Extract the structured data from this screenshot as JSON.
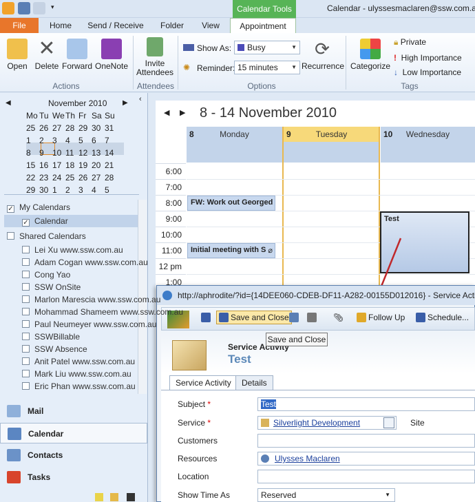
{
  "window": {
    "context_tab": "Calendar Tools",
    "title": "Calendar - ulyssesmaclaren@ssw.com.au"
  },
  "tabs": [
    "File",
    "Home",
    "Send / Receive",
    "Folder",
    "View",
    "Appointment"
  ],
  "ribbon": {
    "actions": {
      "open": "Open",
      "delete": "Delete",
      "forward": "Forward",
      "onenote": "OneNote",
      "group": "Actions"
    },
    "attendees": {
      "invite_line1": "Invite",
      "invite_line2": "Attendees",
      "group": "Attendees"
    },
    "options": {
      "show_as_label": "Show As:",
      "show_as_value": "Busy",
      "reminder_label": "Reminder:",
      "reminder_value": "15 minutes",
      "recurrence": "Recurrence",
      "group": "Options"
    },
    "tags": {
      "categorize": "Categorize",
      "private": "Private",
      "high": "High Importance",
      "low": "Low Importance",
      "group": "Tags"
    },
    "colors": {
      "file_tab": "#e8762b",
      "context": "#57b456"
    }
  },
  "mini_calendar": {
    "month": "November 2010",
    "weekdays": [
      "Mo",
      "Tu",
      "We",
      "Th",
      "Fr",
      "Sa",
      "Su"
    ],
    "weeks": [
      [
        "25",
        "26",
        "27",
        "28",
        "29",
        "30",
        "31"
      ],
      [
        "1",
        "2",
        "3",
        "4",
        "5",
        "6",
        "7"
      ],
      [
        "8",
        "9",
        "10",
        "11",
        "12",
        "13",
        "14"
      ],
      [
        "15",
        "16",
        "17",
        "18",
        "19",
        "20",
        "21"
      ],
      [
        "22",
        "23",
        "24",
        "25",
        "26",
        "27",
        "28"
      ],
      [
        "29",
        "30",
        "1",
        "2",
        "3",
        "4",
        "5"
      ]
    ],
    "today": "9"
  },
  "calendars": {
    "my_header": "My Calendars",
    "my_items": [
      "Calendar"
    ],
    "shared_header": "Shared Calendars",
    "shared_items": [
      "Lei Xu www.ssw.com.au",
      "Adam Cogan www.ssw.com.au",
      "Cong Yao",
      "SSW OnSite",
      "Marlon Marescia www.ssw.com.au",
      "Mohammad Shameem www.ssw.com.au",
      "Paul Neumeyer www.ssw.com.au",
      "SSWBillable",
      "SSW Absence",
      "Anit Patel www.ssw.com.au",
      "Mark Liu www.ssw.com.au",
      "Eric Phan www.ssw.com.au"
    ]
  },
  "nav_buttons": [
    "Mail",
    "Calendar",
    "Contacts",
    "Tasks"
  ],
  "calendar_view": {
    "range": "8 - 14 November 2010",
    "days": [
      {
        "num": "8",
        "name": "Monday"
      },
      {
        "num": "9",
        "name": "Tuesday"
      },
      {
        "num": "10",
        "name": "Wednesday"
      }
    ],
    "times": [
      "6:00",
      "7:00",
      "8:00",
      "9:00",
      "10:00",
      "11:00",
      "12 pm",
      "1:00"
    ],
    "appointments": [
      "FW: Work out Georged",
      "Initial meeting with S",
      "Test"
    ]
  },
  "popup": {
    "title": "http://aphrodite/?id={14DEE060-CDEB-DF11-A282-00155D012016} - Service Activity",
    "toolbar": {
      "save_close": "Save and Close",
      "follow_up": "Follow Up",
      "schedule": "Schedule..."
    },
    "tooltip": "Save and Close",
    "entity_type": "Service Activity",
    "entity_name": "Test",
    "tabs": [
      "Service Activity",
      "Details"
    ],
    "fields": {
      "subject_label": "Subject",
      "subject_value": "Test",
      "service_label": "Service",
      "service_value": "Silverlight Development",
      "site_label": "Site",
      "customers_label": "Customers",
      "resources_label": "Resources",
      "resources_value": "Ulysses Maclaren",
      "location_label": "Location",
      "show_time_label": "Show Time As",
      "show_time_value": "Reserved"
    },
    "required_mark": "*"
  }
}
